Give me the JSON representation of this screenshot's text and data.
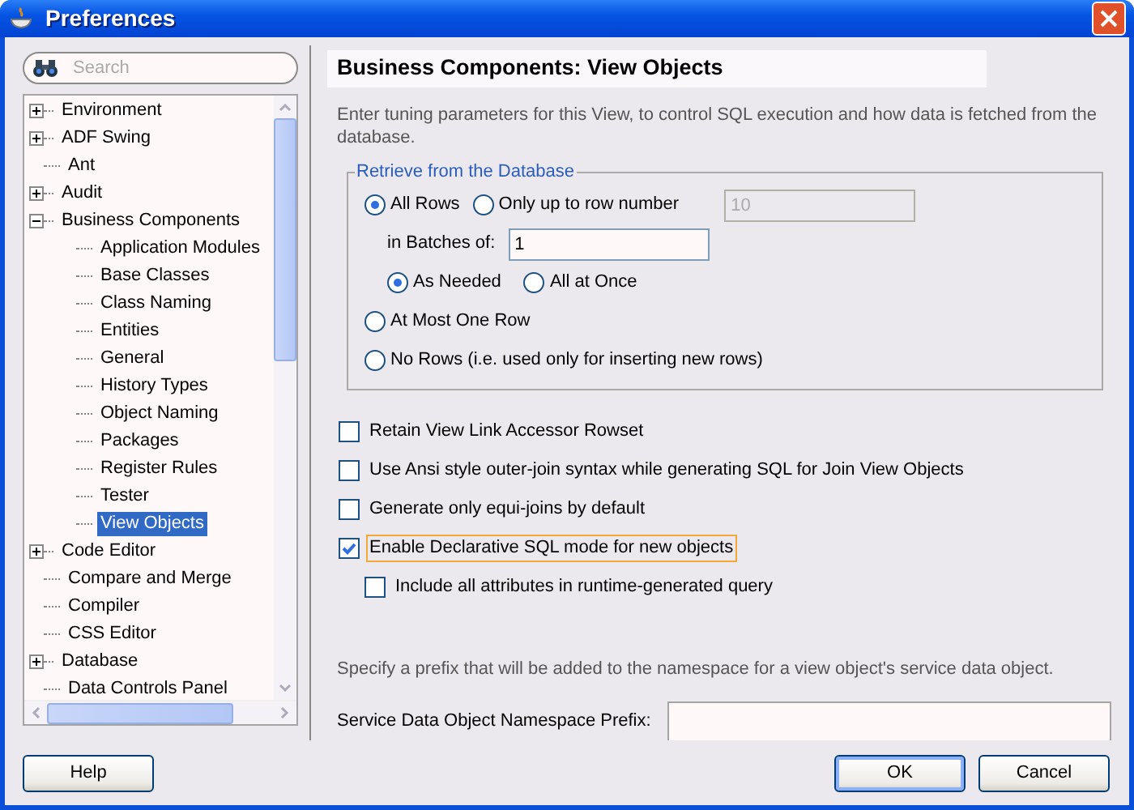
{
  "window": {
    "title": "Preferences"
  },
  "search": {
    "placeholder": "Search"
  },
  "tree": [
    {
      "label": "Environment",
      "kind": "group",
      "expanded": false,
      "selected": false
    },
    {
      "label": "ADF Swing",
      "kind": "group",
      "expanded": false,
      "selected": false
    },
    {
      "label": "Ant",
      "kind": "leaf",
      "selected": false
    },
    {
      "label": "Audit",
      "kind": "group",
      "expanded": false,
      "selected": false
    },
    {
      "label": "Business Components",
      "kind": "group",
      "expanded": true,
      "selected": false,
      "children": [
        {
          "label": "Application Modules",
          "kind": "leaf",
          "selected": false
        },
        {
          "label": "Base Classes",
          "kind": "leaf",
          "selected": false
        },
        {
          "label": "Class Naming",
          "kind": "leaf",
          "selected": false
        },
        {
          "label": "Entities",
          "kind": "leaf",
          "selected": false
        },
        {
          "label": "General",
          "kind": "leaf",
          "selected": false
        },
        {
          "label": "History Types",
          "kind": "leaf",
          "selected": false
        },
        {
          "label": "Object Naming",
          "kind": "leaf",
          "selected": false
        },
        {
          "label": "Packages",
          "kind": "leaf",
          "selected": false
        },
        {
          "label": "Register Rules",
          "kind": "leaf",
          "selected": false
        },
        {
          "label": "Tester",
          "kind": "leaf",
          "selected": false
        },
        {
          "label": "View Objects",
          "kind": "leaf",
          "selected": true
        }
      ]
    },
    {
      "label": "Code Editor",
      "kind": "group",
      "expanded": false,
      "selected": false
    },
    {
      "label": "Compare and Merge",
      "kind": "leaf",
      "selected": false
    },
    {
      "label": "Compiler",
      "kind": "leaf",
      "selected": false
    },
    {
      "label": "CSS Editor",
      "kind": "leaf",
      "selected": false
    },
    {
      "label": "Database",
      "kind": "group",
      "expanded": false,
      "selected": false
    },
    {
      "label": "Data Controls Panel",
      "kind": "leaf",
      "selected": false
    }
  ],
  "page": {
    "heading": "Business Components: View Objects",
    "description": "Enter tuning parameters for this View, to control SQL execution and how data is fetched from the database.",
    "group_box": {
      "title": "Retrieve from the Database",
      "row_limit": [
        {
          "label": "All Rows",
          "selected": true
        },
        {
          "label": "Only up to row number",
          "selected": false
        }
      ],
      "row_number_field": {
        "value": "10",
        "disabled": true
      },
      "batches_label": "in Batches of:",
      "batches_field": {
        "value": "1",
        "disabled": false
      },
      "batch_mode": [
        {
          "label": "As Needed",
          "selected": true
        },
        {
          "label": "All at Once",
          "selected": false
        }
      ],
      "other_modes": [
        {
          "label": "At Most One Row",
          "selected": false
        },
        {
          "label": "No Rows (i.e. used only for inserting new rows)",
          "selected": false
        }
      ]
    },
    "checkboxes": [
      {
        "label": "Retain View Link Accessor Rowset",
        "checked": false,
        "focused": false
      },
      {
        "label": "Use Ansi style outer-join syntax while generating SQL for Join View Objects",
        "checked": false,
        "focused": false
      },
      {
        "label": "Generate only equi-joins by default",
        "checked": false,
        "focused": false
      },
      {
        "label": "Enable Declarative SQL mode for new objects",
        "checked": true,
        "focused": true,
        "children": [
          {
            "label": "Include all attributes in runtime-generated query",
            "checked": false,
            "focused": false
          }
        ]
      }
    ],
    "prefix_note": "Specify a prefix that will be added to the namespace for a view object's service data object.",
    "prefix_label": "Service Data Object Namespace Prefix:"
  },
  "buttons": [
    {
      "label": "Help",
      "default": false
    },
    {
      "label": "OK",
      "default": true
    },
    {
      "label": "Cancel",
      "default": false
    }
  ]
}
